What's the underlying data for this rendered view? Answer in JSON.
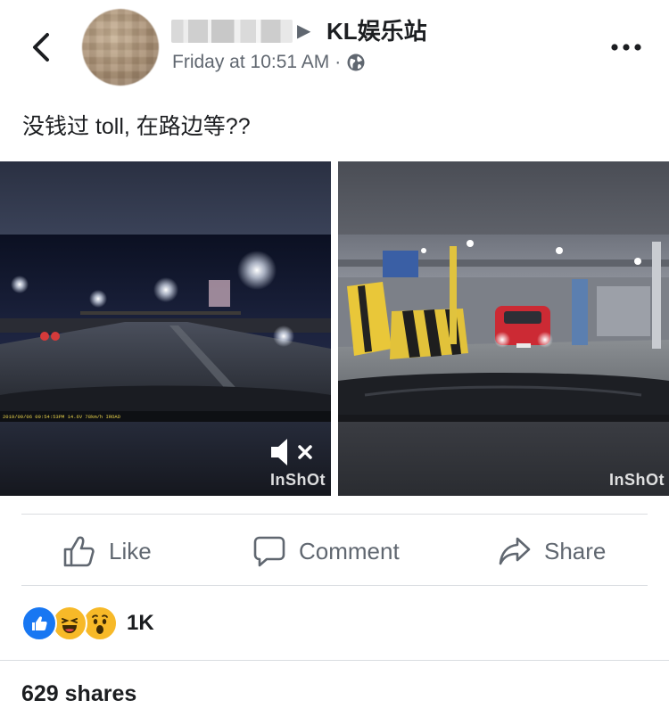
{
  "header": {
    "group_name": "KL娱乐站",
    "timestamp": "Friday at 10:51 AM",
    "separator": "·",
    "audience_icon": "globe-icon",
    "back_icon": "chevron-left-icon",
    "more_icon": "more-horizontal-icon"
  },
  "post": {
    "text": "没钱过 toll, 在路边等??"
  },
  "media": {
    "left_video": {
      "watermark": "InShOt",
      "dashcam_overlay": "2019/09/06 09:54:53PM 14.6V 78km/h  IROAD",
      "mute_icon": "speaker-muted-icon"
    },
    "right_video": {
      "watermark": "InShOt"
    }
  },
  "actions": {
    "like": "Like",
    "comment": "Comment",
    "share": "Share"
  },
  "reactions": {
    "types": [
      "like",
      "haha",
      "wow"
    ],
    "count": "1K"
  },
  "shares": {
    "label": "629 shares"
  },
  "colors": {
    "text": "#1c1e21",
    "secondary": "#606770",
    "divider": "#dadde1",
    "like_blue": "#1877f2",
    "reaction_yellow": "#f7b928"
  }
}
